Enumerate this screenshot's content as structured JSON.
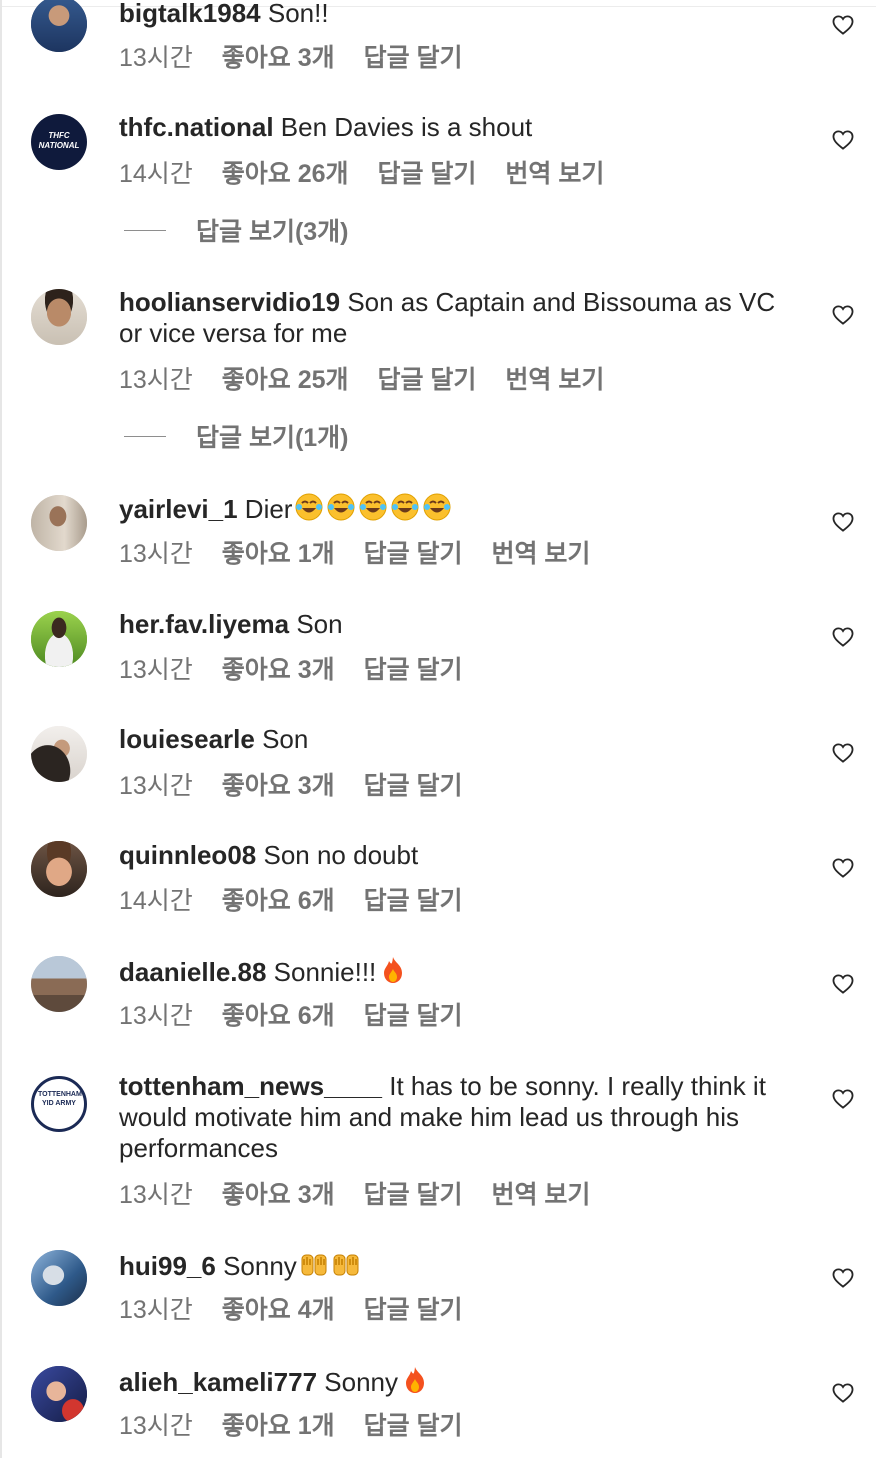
{
  "comments": [
    {
      "username": "bigtalk1984",
      "text": "Son!!",
      "time": "13시간",
      "likes": "좋아요 3개",
      "reply": "답글 달기",
      "translate": ""
    },
    {
      "username": "thfc.national",
      "text": "Ben Davies is a shout",
      "time": "14시간",
      "likes": "좋아요 26개",
      "reply": "답글 달기",
      "translate": "번역 보기",
      "avatar_text": "THFC NATIONAL",
      "view_replies": "답글 보기(3개)"
    },
    {
      "username": "hoolianservidio19",
      "text": "Son as Captain and Bissouma as VC or vice versa for me",
      "time": "13시간",
      "likes": "좋아요 25개",
      "reply": "답글 달기",
      "translate": "번역 보기",
      "view_replies": "답글 보기(1개)"
    },
    {
      "username": "yairlevi_1",
      "text": "Dier",
      "emoji": "face-with-tears-of-joy ×5",
      "time": "13시간",
      "likes": "좋아요 1개",
      "reply": "답글 달기",
      "translate": "번역 보기"
    },
    {
      "username": "her.fav.liyema",
      "text": "Son",
      "time": "13시간",
      "likes": "좋아요 3개",
      "reply": "답글 달기",
      "translate": ""
    },
    {
      "username": "louiesearle",
      "text": "Son",
      "time": "13시간",
      "likes": "좋아요 3개",
      "reply": "답글 달기",
      "translate": ""
    },
    {
      "username": "quinnleo08",
      "text": "Son no doubt",
      "time": "14시간",
      "likes": "좋아요 6개",
      "reply": "답글 달기",
      "translate": ""
    },
    {
      "username": "daanielle.88",
      "text": "Sonnie!!!",
      "emoji": "fire",
      "time": "13시간",
      "likes": "좋아요 6개",
      "reply": "답글 달기",
      "translate": ""
    },
    {
      "username": "tottenham_news____",
      "text": "It has to be sonny. I really think it would motivate him and make him lead us through his performances",
      "time": "13시간",
      "likes": "좋아요 3개",
      "reply": "답글 달기",
      "translate": "번역 보기",
      "avatar_text": "TOTTENHAM YID ARMY"
    },
    {
      "username": "hui99_6",
      "text": "Sonny",
      "emoji": "raising-hands ×2",
      "time": "13시간",
      "likes": "좋아요 4개",
      "reply": "답글 달기",
      "translate": ""
    },
    {
      "username": "alieh_kameli777",
      "text": "Sonny",
      "emoji": "fire",
      "time": "13시간",
      "likes": "좋아요 1개",
      "reply": "답글 달기",
      "translate": ""
    }
  ],
  "icons": {
    "like": "heart-outline-icon"
  },
  "colors": {
    "text": "#262626",
    "secondary": "#737373",
    "background": "#ffffff"
  }
}
